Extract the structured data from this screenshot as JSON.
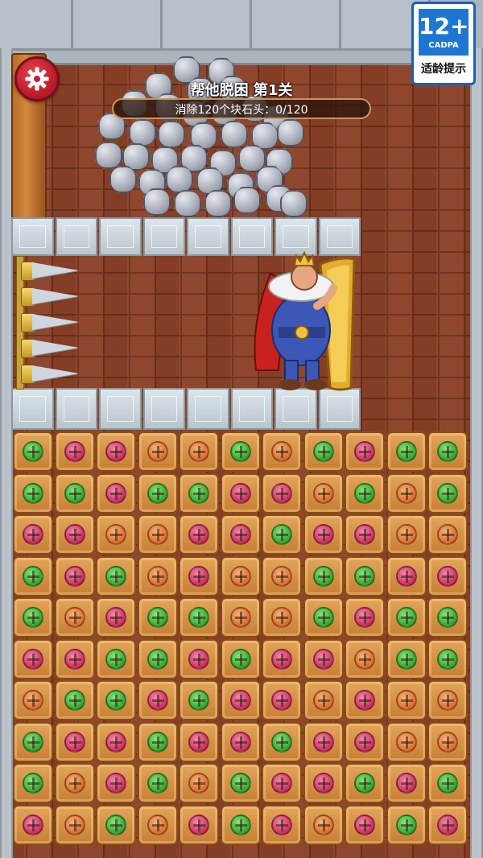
{
  "badge": {
    "age": "12+",
    "org": "CADPA",
    "tip": "适龄提示"
  },
  "level": {
    "title": "帮他脱困 第1关",
    "goal": "消除120个块石头：0/120"
  },
  "settings_icon": "gear-icon",
  "colors": {
    "green": "#36a52f",
    "pink": "#cc2f5d",
    "orange": "#dd6c2d",
    "gear": "#c61f2e"
  },
  "board": {
    "rows": [
      [
        "g",
        "p",
        "p",
        "o",
        "o",
        "g",
        "o",
        "g",
        "p",
        "g",
        "g"
      ],
      [
        "g",
        "g",
        "p",
        "g",
        "g",
        "p",
        "p",
        "o",
        "g",
        "o",
        "g"
      ],
      [
        "p",
        "p",
        "o",
        "o",
        "p",
        "p",
        "g",
        "p",
        "p",
        "o",
        "o"
      ],
      [
        "g",
        "p",
        "g",
        "o",
        "p",
        "o",
        "o",
        "g",
        "g",
        "p",
        "p"
      ],
      [
        "g",
        "o",
        "p",
        "g",
        "g",
        "o",
        "o",
        "g",
        "p",
        "g",
        "g"
      ],
      [
        "p",
        "p",
        "g",
        "g",
        "p",
        "g",
        "p",
        "p",
        "o",
        "g",
        "g"
      ],
      [
        "o",
        "g",
        "g",
        "p",
        "g",
        "p",
        "p",
        "o",
        "p",
        "o",
        "o"
      ],
      [
        "g",
        "p",
        "p",
        "g",
        "p",
        "p",
        "g",
        "p",
        "p",
        "o",
        "o"
      ],
      [
        "g",
        "o",
        "p",
        "g",
        "o",
        "g",
        "p",
        "p",
        "g",
        "p",
        "g"
      ],
      [
        "p",
        "o",
        "g",
        "o",
        "p",
        "g",
        "p",
        "o",
        "p",
        "g",
        "p"
      ]
    ]
  }
}
